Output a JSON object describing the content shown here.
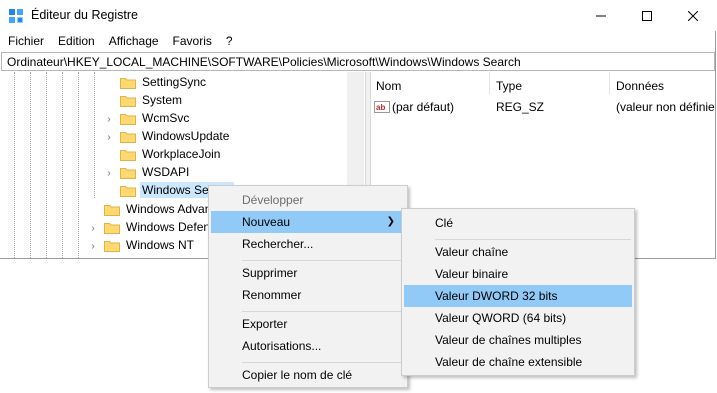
{
  "window": {
    "title": "Éditeur du Registre",
    "controls": {
      "minimize": "—",
      "maximize": "☐",
      "close": "✕"
    }
  },
  "menubar": [
    "Fichier",
    "Edition",
    "Affichage",
    "Favoris",
    "?"
  ],
  "address": "Ordinateur\\HKEY_LOCAL_MACHINE\\SOFTWARE\\Policies\\Microsoft\\Windows\\Windows Search",
  "tree": {
    "items": [
      {
        "label": "SettingSync",
        "expander": false
      },
      {
        "label": "System",
        "expander": false
      },
      {
        "label": "WcmSvc",
        "expander": true
      },
      {
        "label": "WindowsUpdate",
        "expander": true
      },
      {
        "label": "WorkplaceJoin",
        "expander": false
      },
      {
        "label": "WSDAPI",
        "expander": true
      },
      {
        "label": "Windows Search",
        "expander": false,
        "selected": true
      },
      {
        "label": "Windows Advanced Threat Protection",
        "expander": false
      },
      {
        "label": "Windows Defender",
        "expander": true
      },
      {
        "label": "Windows NT",
        "expander": true
      }
    ]
  },
  "values_pane": {
    "columns": [
      "Nom",
      "Type",
      "Données"
    ],
    "rows": [
      {
        "name": "(par défaut)",
        "type": "REG_SZ",
        "data": "(valeur non définie)"
      }
    ]
  },
  "context_menu": {
    "items": [
      {
        "label": "Développer",
        "disabled": true
      },
      {
        "label": "Nouveau",
        "highlighted": true,
        "submenu": true
      },
      {
        "label": "Rechercher..."
      },
      {
        "label": "Supprimer"
      },
      {
        "label": "Renommer"
      },
      {
        "label": "Exporter"
      },
      {
        "label": "Autorisations..."
      },
      {
        "label": "Copier le nom de clé"
      }
    ]
  },
  "submenu": {
    "items": [
      {
        "label": "Clé"
      },
      {
        "label": "Valeur chaîne"
      },
      {
        "label": "Valeur binaire"
      },
      {
        "label": "Valeur DWORD 32 bits",
        "highlighted": true
      },
      {
        "label": "Valeur QWORD (64 bits)"
      },
      {
        "label": "Valeur de chaînes multiples"
      },
      {
        "label": "Valeur de chaîne extensible"
      }
    ]
  },
  "colors": {
    "selection": "#cce8ff",
    "menu_highlight": "#91c9f7",
    "folder": "#ffd970",
    "menu_bg": "#f2f2f2"
  },
  "icons": {
    "app": "registry-editor-icon",
    "folder": "folder-icon",
    "value": "string-value-ab-icon",
    "expander": "chevron-right-icon"
  }
}
